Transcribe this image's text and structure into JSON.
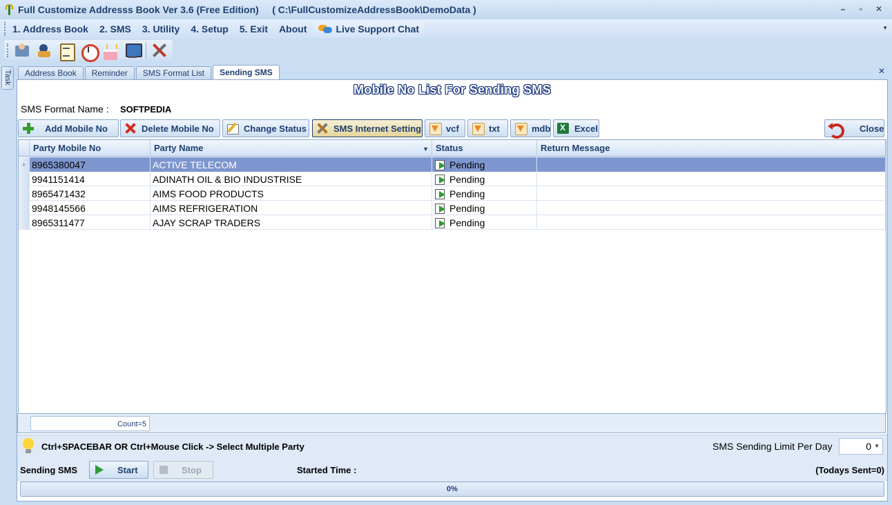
{
  "window": {
    "title": "Full Customize Addresss Book Ver 3.6 (Free Edition)     ( C:\\FullCustomizeAddressBook\\DemoData )",
    "minimize": "–",
    "maximize": "▫",
    "close": "✕"
  },
  "menu": {
    "items": [
      "1. Address Book",
      "2. SMS",
      "3. Utility",
      "4. Setup",
      "5. Exit",
      "About"
    ],
    "live_support": "Live Support Chat",
    "overflow": "▼"
  },
  "toolbar": {
    "icons": [
      "contacts-card-icon",
      "person-icon",
      "clipboard-icon",
      "alarm-clock-icon",
      "birthday-cake-icon",
      "monitor-icon",
      "tools-icon"
    ]
  },
  "side_tab": {
    "label": "Task"
  },
  "tabs": {
    "items": [
      "Address Book",
      "Reminder",
      "SMS Format List",
      "Sending SMS"
    ],
    "active_index": 3,
    "close": "✕"
  },
  "panel": {
    "title": "Mobile No List For Sending SMS",
    "format_label": "SMS Format Name :",
    "format_value": "SOFTPEDIA"
  },
  "buttons": {
    "add": "Add Mobile No",
    "delete": "Delete Mobile No",
    "change_status": "Change Status",
    "internet_setting": "SMS Internet Setting",
    "vcf": "vcf",
    "txt": "txt",
    "mdb": "mdb",
    "excel": "Excel",
    "close": "Close"
  },
  "grid": {
    "columns": [
      "Party Mobile No",
      "Party Name",
      "Status",
      "Return Message"
    ],
    "filter_icon": "▼",
    "row_indicator": "›",
    "selected_row": 0,
    "rows": [
      {
        "mobile": "8965380047",
        "name": "ACTIVE TELECOM",
        "status": "Pending",
        "message": ""
      },
      {
        "mobile": "9941151414",
        "name": "ADINATH OIL & BIO INDUSTRISE",
        "status": "Pending",
        "message": ""
      },
      {
        "mobile": "8965471432",
        "name": "AIMS FOOD PRODUCTS",
        "status": "Pending",
        "message": ""
      },
      {
        "mobile": "9948145566",
        "name": "AIMS REFRIGERATION",
        "status": "Pending",
        "message": ""
      },
      {
        "mobile": "8965311477",
        "name": "AJAY SCRAP TRADERS",
        "status": "Pending",
        "message": ""
      }
    ],
    "count": "Count=5"
  },
  "hint": {
    "text": "Ctrl+SPACEBAR  OR  Ctrl+Mouse Click -> Select Multiple Party",
    "limit_label": "SMS Sending Limit Per Day",
    "limit_value": "0",
    "limit_dd": "▼"
  },
  "sending": {
    "label": "Sending SMS",
    "start": "Start",
    "stop": "Stop",
    "started_time_label": "Started Time :",
    "todays_sent": "(Todays Sent=0)"
  },
  "progress": {
    "value": 0,
    "text": "0%"
  }
}
